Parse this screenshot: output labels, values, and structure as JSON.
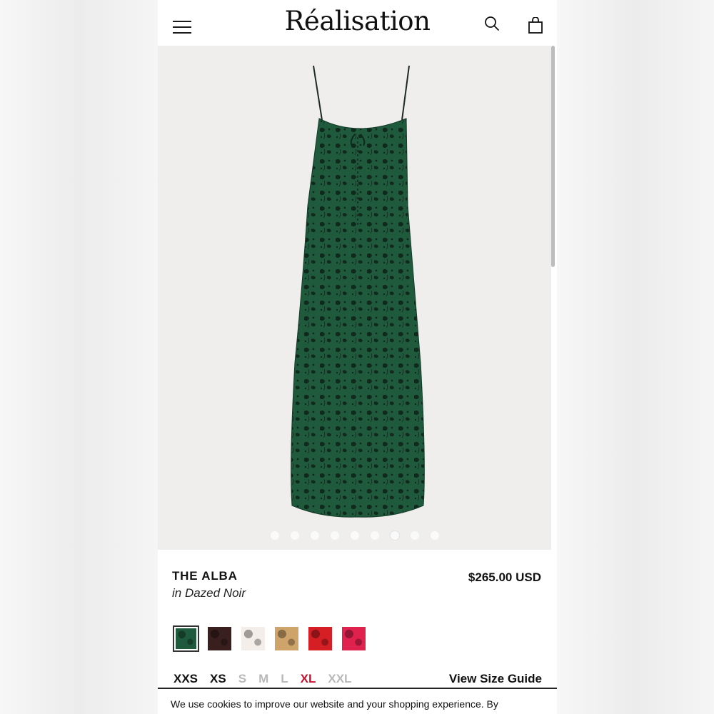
{
  "brand": {
    "logo_text": "Réalisation"
  },
  "header": {
    "menu_icon": "hamburger-icon",
    "search_icon": "search-icon",
    "bag_icon": "shopping-bag-icon"
  },
  "gallery": {
    "dot_count": 9,
    "active_index": 6
  },
  "product": {
    "name": "THE ALBA",
    "variant": "in Dazed Noir",
    "price": "$265.00 USD",
    "swatch_colors": [
      "#1f5a3c",
      "#3a1f1f",
      "#f3eeea",
      "#cfa46a",
      "#d51f24",
      "#e0214e"
    ]
  },
  "sizes": [
    {
      "label": "XXS",
      "status": "available"
    },
    {
      "label": "XS",
      "status": "available"
    },
    {
      "label": "S",
      "status": "unavailable"
    },
    {
      "label": "M",
      "status": "unavailable"
    },
    {
      "label": "L",
      "status": "unavailable"
    },
    {
      "label": "XL",
      "status": "low"
    },
    {
      "label": "XXL",
      "status": "unavailable"
    }
  ],
  "size_guide_label": "View Size Guide",
  "cookie_banner": {
    "text": "We use cookies to improve our website and your shopping experience. By"
  },
  "colors": {
    "low_stock": "#c8102e",
    "unavailable": "#b9b9b9",
    "dress_green": "#1f5a3c"
  }
}
